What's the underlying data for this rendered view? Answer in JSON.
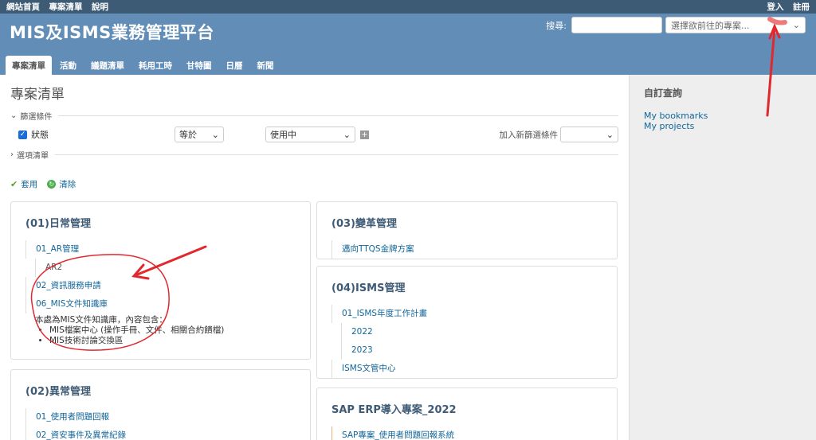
{
  "top_menu": {
    "left": [
      "網站首頁",
      "專案清單",
      "說明"
    ],
    "right": [
      "登入",
      "註冊"
    ]
  },
  "header": {
    "title": "MIS及ISMS業務管理平台",
    "search_label": "搜尋:",
    "search_value": "",
    "project_jump": "選擇欲前往的專案...",
    "tabs": [
      "專案清單",
      "活動",
      "議題清單",
      "耗用工時",
      "甘特圖",
      "日曆",
      "新聞"
    ]
  },
  "page": {
    "title": "專案清單",
    "filters_legend": "篩選條件",
    "filter_status_label": "狀態",
    "filter_operator": "等於",
    "filter_value": "使用中",
    "add_filter_label": "加入新篩選條件",
    "add_filter_value": "",
    "options_legend": "選項清單",
    "apply_label": "套用",
    "clear_label": "清除"
  },
  "boxes": {
    "b01": {
      "title": "(01)日常管理",
      "items": [
        "01_AR管理",
        "AR2",
        "02_資訊服務申請",
        "06_MIS文件知識庫"
      ],
      "desc": "本處為MIS文件知識庫，內容包含：",
      "bullets": [
        "MIS檔案中心 (操作手冊、文件、相關合約饋檔)",
        "MIS技術討論交換區"
      ]
    },
    "b02": {
      "title": "(02)異常管理",
      "items": [
        "01_使用者問題回報",
        "02_資安事件及異常紀錄"
      ]
    },
    "b03": {
      "title": "(03)變革管理",
      "items": [
        "邁向TTQS金牌方案"
      ]
    },
    "b04": {
      "title": "(04)ISMS管理",
      "items": [
        "01_ISMS年度工作計畫",
        "2022",
        "2023",
        "ISMS文管中心"
      ]
    },
    "b05": {
      "title": "SAP ERP導入專案_2022",
      "items": [
        "SAP專案_使用者問題回報系統"
      ]
    }
  },
  "sidebar": {
    "title": "自訂查詢",
    "links": [
      "My bookmarks",
      "My projects"
    ]
  },
  "colors": {
    "top_menu_bg": "#3e5b76",
    "header_bg": "#628db6",
    "link": "#116699",
    "annotation": "#e0282e"
  }
}
